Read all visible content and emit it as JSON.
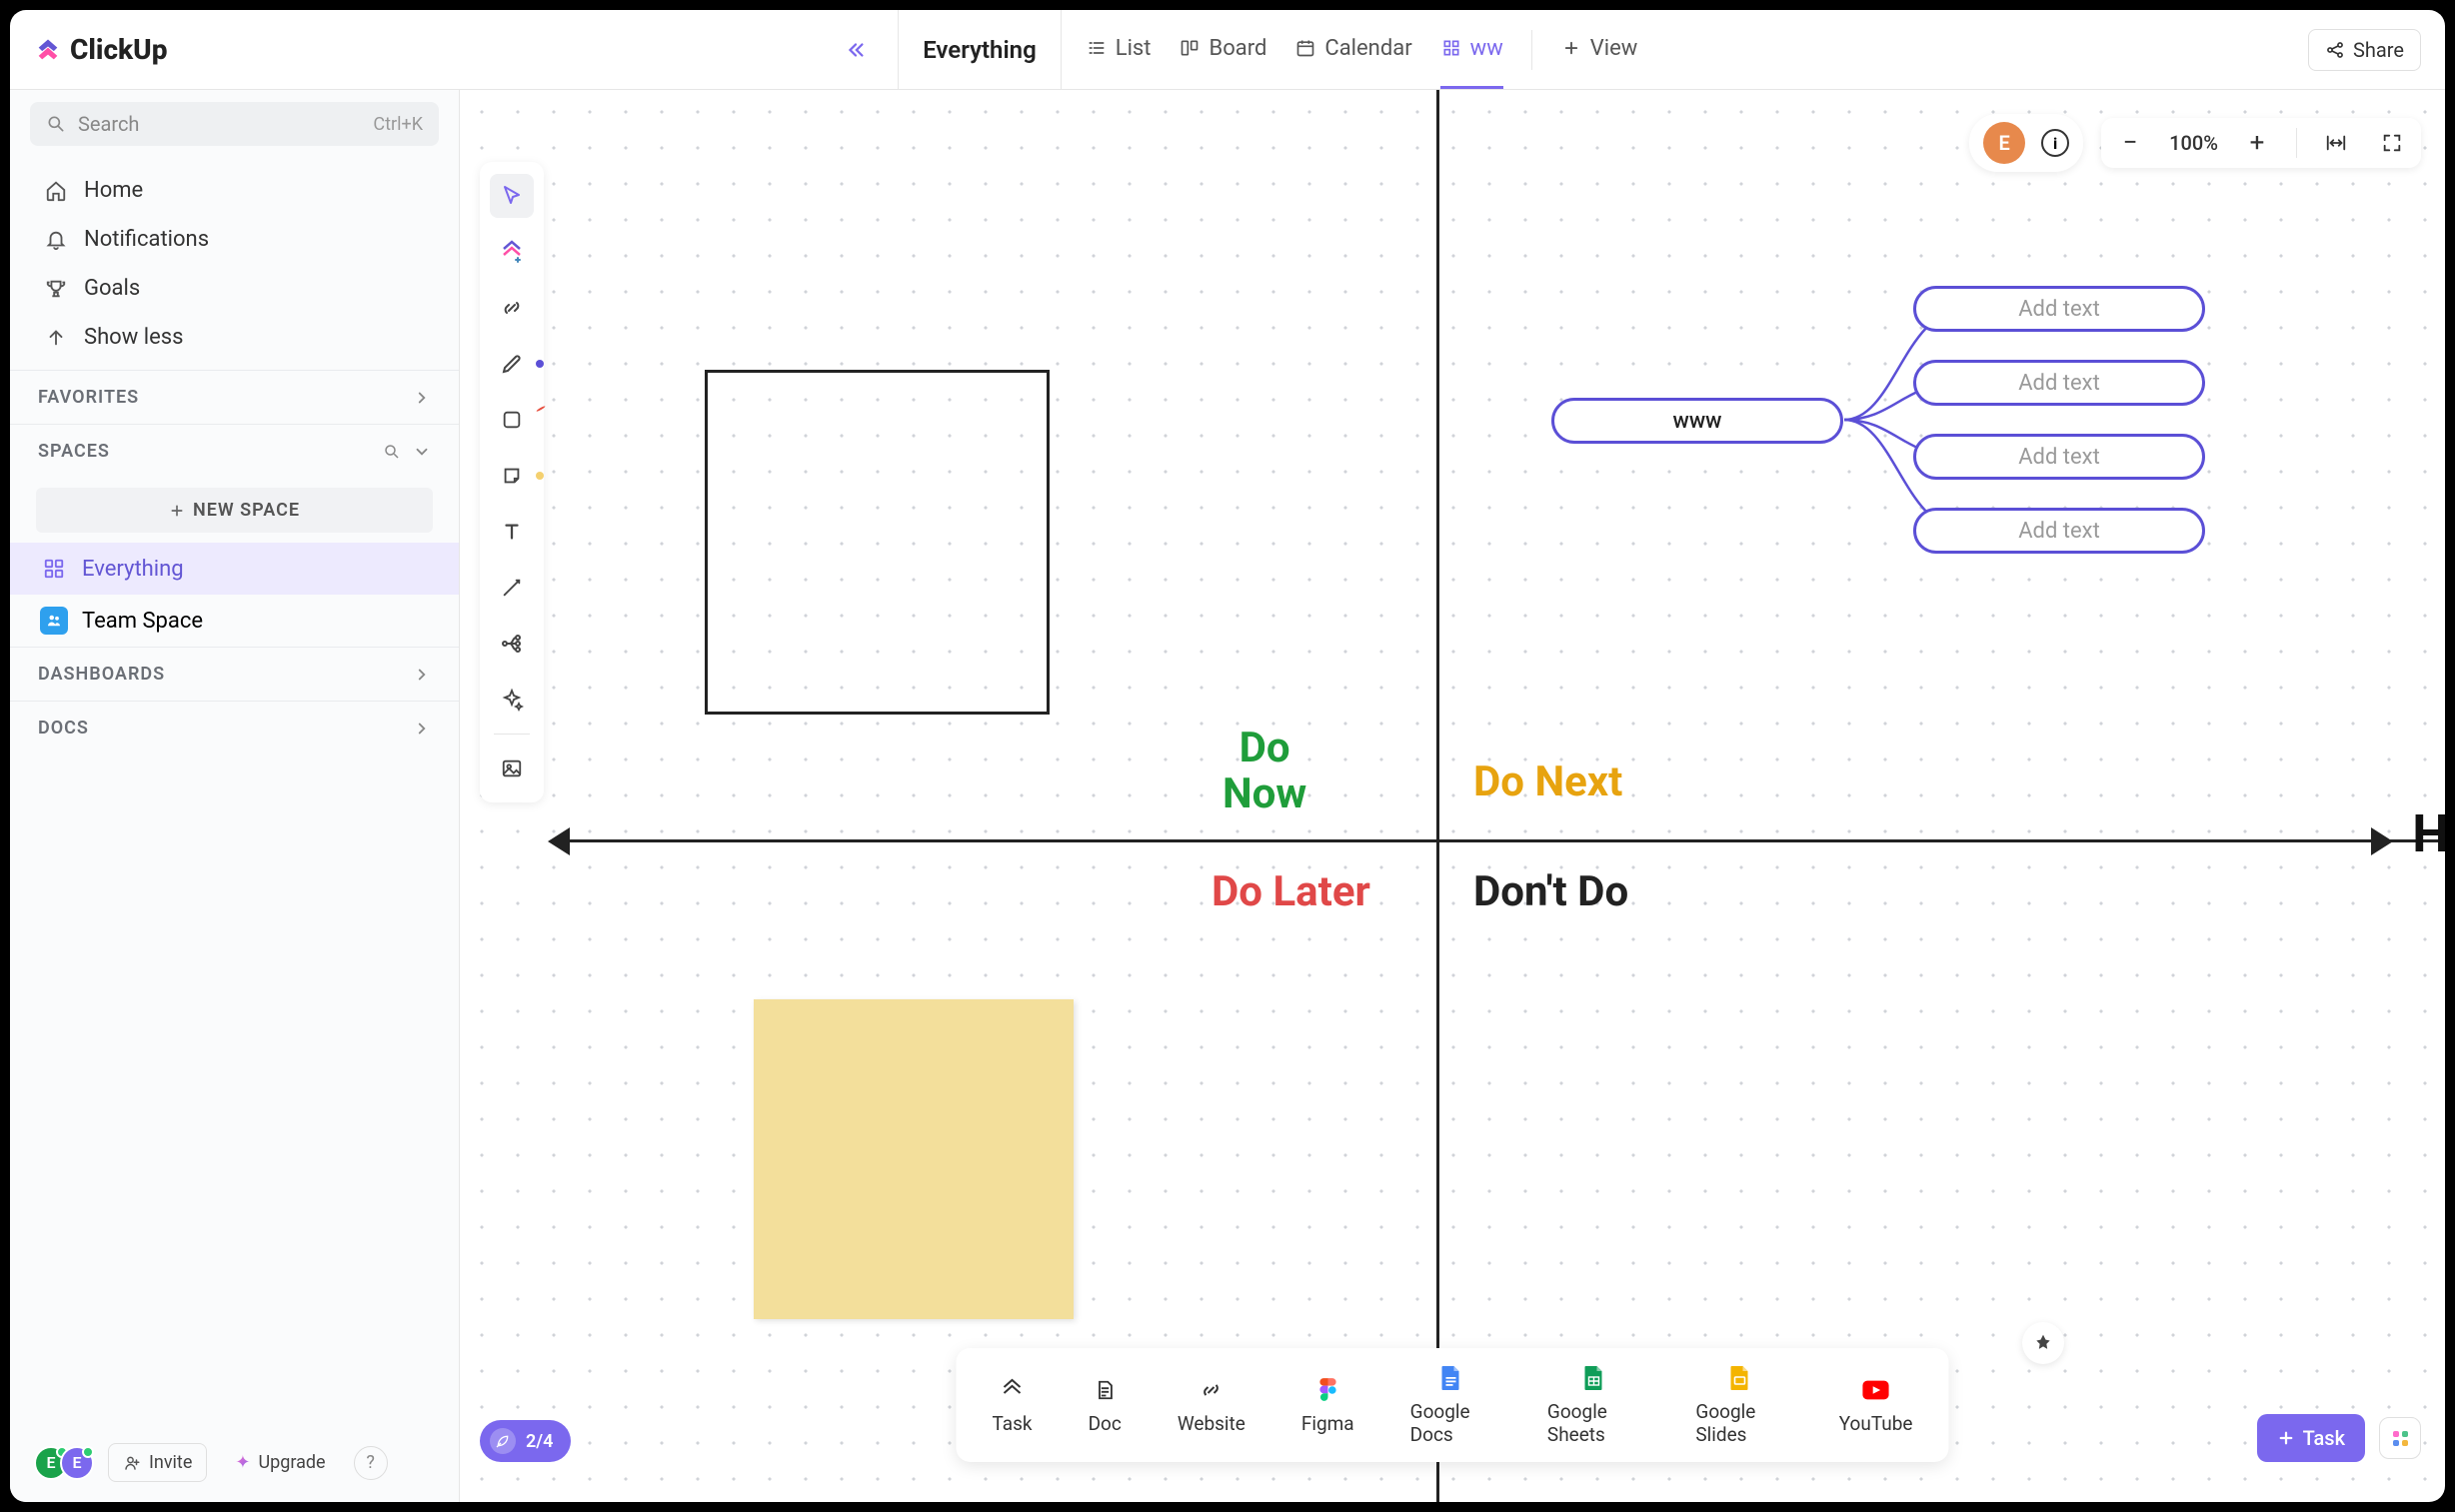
{
  "brand": {
    "name": "ClickUp"
  },
  "topbar": {
    "title": "Everything",
    "tabs": [
      {
        "label": "List"
      },
      {
        "label": "Board"
      },
      {
        "label": "Calendar"
      },
      {
        "label": "ww"
      },
      {
        "label": "View"
      }
    ],
    "share": "Share"
  },
  "sidebar": {
    "search_placeholder": "Search",
    "search_hint": "Ctrl+K",
    "nav": [
      {
        "label": "Home"
      },
      {
        "label": "Notifications"
      },
      {
        "label": "Goals"
      },
      {
        "label": "Show less"
      }
    ],
    "favorites_header": "FAVORITES",
    "spaces_header": "SPACES",
    "new_space": "NEW SPACE",
    "spaces": [
      {
        "label": "Everything"
      },
      {
        "label": "Team Space"
      }
    ],
    "dashboards_header": "DASHBOARDS",
    "docs_header": "DOCS",
    "invite": "Invite",
    "upgrade": "Upgrade",
    "avatar_a": "E",
    "avatar_b": "E"
  },
  "whiteboard": {
    "zoom": "100%",
    "avatar": "E",
    "quad": {
      "do_now": "Do\nNow",
      "do_next": "Do Next",
      "do_later": "Do Later",
      "dont_do": "Don't Do"
    },
    "axis_end": "H",
    "mindmap": {
      "root": "www",
      "children": [
        "Add text",
        "Add text",
        "Add text",
        "Add text"
      ]
    }
  },
  "objectbar": [
    {
      "label": "Task"
    },
    {
      "label": "Doc"
    },
    {
      "label": "Website"
    },
    {
      "label": "Figma"
    },
    {
      "label": "Google Docs"
    },
    {
      "label": "Google Sheets"
    },
    {
      "label": "Google Slides"
    },
    {
      "label": "YouTube"
    }
  ],
  "onboarding": "2/4",
  "task_button": "Task"
}
